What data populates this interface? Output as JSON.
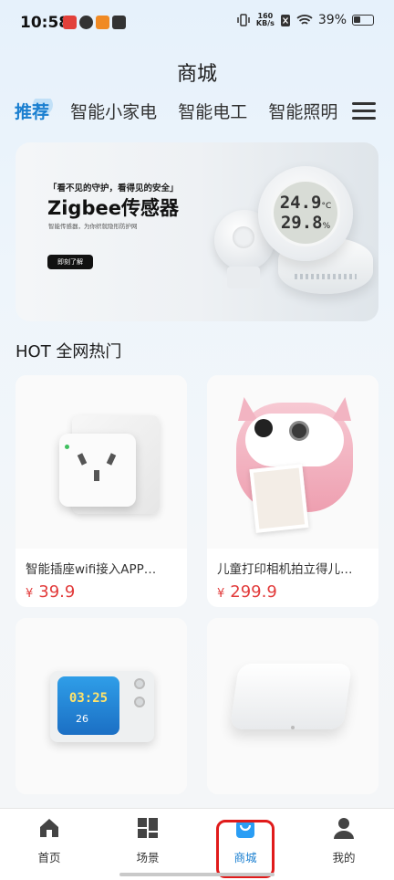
{
  "status_bar": {
    "time": "10:58",
    "speed_top": "160",
    "speed_bottom": "KB/s",
    "battery": "39%"
  },
  "header": {
    "title": "商城"
  },
  "tabs": [
    {
      "label": "推荐",
      "active": true
    },
    {
      "label": "智能小家电"
    },
    {
      "label": "智能电工"
    },
    {
      "label": "智能照明"
    }
  ],
  "banner": {
    "tagline": "「看不见的守护，看得见的安全」",
    "title": "Zigbee传感器",
    "subtitle": "智能传感器，为你织就隐形防护网",
    "button": "即刻了解",
    "display_temp": "24.9",
    "display_temp_unit": "°C",
    "display_humidity": "29.8",
    "display_humidity_unit": "%"
  },
  "section": {
    "title": "HOT 全网热门"
  },
  "products": [
    {
      "name": "智能插座wifi接入APP…",
      "currency": "¥",
      "price": "39.9",
      "image": "smart-plug"
    },
    {
      "name": "儿童打印相机拍立得儿…",
      "currency": "¥",
      "price": "299.9",
      "image": "kids-camera"
    },
    {
      "name": "",
      "currency": "",
      "price": "",
      "image": "retro-tv-clock",
      "clock_time": "03:25",
      "clock_temp": "26"
    },
    {
      "name": "",
      "currency": "",
      "price": "",
      "image": "smart-gateway"
    }
  ],
  "bottom_nav": [
    {
      "label": "首页",
      "icon": "home-icon"
    },
    {
      "label": "场景",
      "icon": "grid-icon"
    },
    {
      "label": "商城",
      "icon": "shopping-bag-icon",
      "active": true
    },
    {
      "label": "我的",
      "icon": "person-icon"
    }
  ],
  "colors": {
    "accent": "#1a7fd0",
    "price": "#e23b3b",
    "highlight": "#e01b1b"
  }
}
